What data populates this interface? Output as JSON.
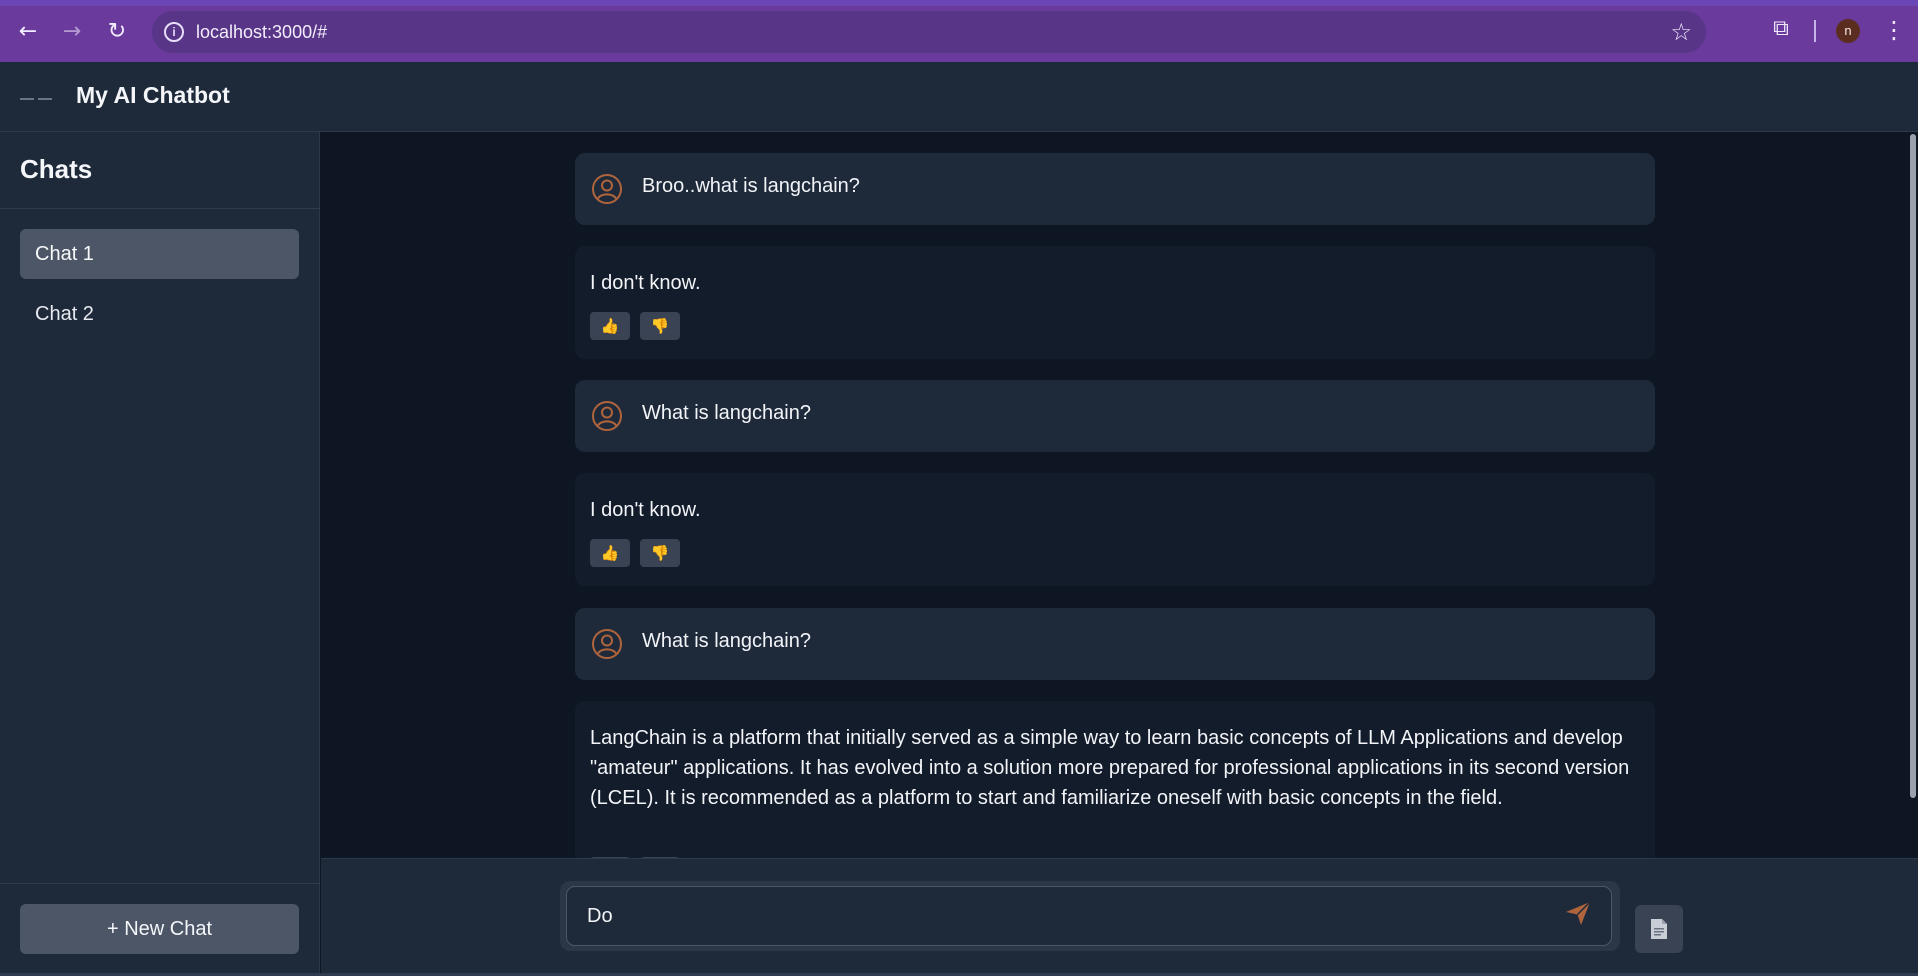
{
  "browser": {
    "url": "localhost:3000/#",
    "profile_initial": "n"
  },
  "header": {
    "title": "My AI Chatbot"
  },
  "sidebar": {
    "title": "Chats",
    "items": [
      {
        "label": "Chat 1",
        "active": true
      },
      {
        "label": "Chat 2",
        "active": false
      }
    ],
    "new_chat_label": "+ New Chat"
  },
  "messages": [
    {
      "role": "user",
      "text": "Broo..what is langchain?"
    },
    {
      "role": "bot",
      "text": "I don't know.",
      "feedback": [
        "👍",
        "👎"
      ]
    },
    {
      "role": "user",
      "text": "What is langchain?"
    },
    {
      "role": "bot",
      "text": "I don't know.",
      "feedback": [
        "👍",
        "👎"
      ]
    },
    {
      "role": "user",
      "text": "What is langchain?"
    },
    {
      "role": "bot",
      "text": "LangChain is a platform that initially served as a simple way to learn basic concepts of LLM Applications and develop \"amateur\" applications. It has evolved into a solution more prepared for professional applications in its second version (LCEL). It is recommended as a platform to start and familiarize oneself with basic concepts in the field."
    }
  ],
  "composer": {
    "value": "Do"
  },
  "colors": {
    "accent_icon": "#b0643c",
    "browser_bar": "#6a3a9c"
  }
}
